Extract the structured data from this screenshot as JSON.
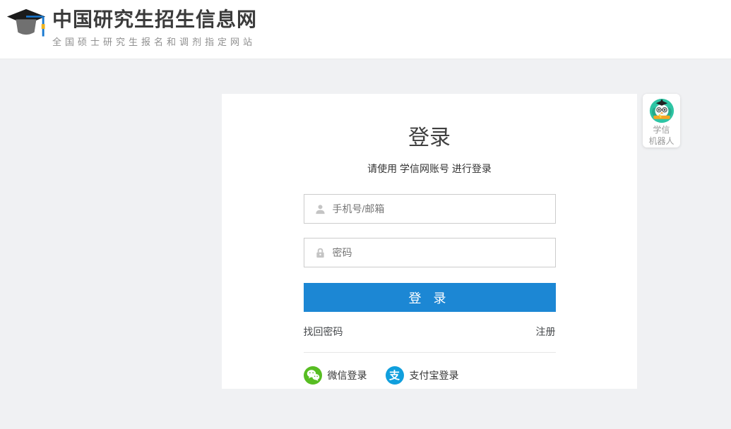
{
  "header": {
    "title": "中国研究生招生信息网",
    "subtitle": "全国硕士研究生报名和调剂指定网站"
  },
  "login": {
    "title": "登录",
    "subtitle": "请使用 学信网账号 进行登录",
    "account_placeholder": "手机号/邮箱",
    "account_value": "",
    "password_placeholder": "密码",
    "password_value": "",
    "login_button": "登 录",
    "forgot_password": "找回密码",
    "register": "注册",
    "wechat_login": "微信登录",
    "alipay_login": "支付宝登录"
  },
  "robot_widget": {
    "label_line1": "学信",
    "label_line2": "机器人"
  },
  "icons": {
    "brand_logo": "graduation-cap-icon",
    "account": "person-icon",
    "password": "lock-icon",
    "wechat": "wechat-icon",
    "alipay": "alipay-icon",
    "robot": "robot-avatar-icon"
  },
  "colors": {
    "page_background": "#f0f1f3",
    "primary_button_blue": "#1c87d4",
    "wechat_green": "#57bd22",
    "alipay_blue": "#109fdd",
    "robot_teal": "#2ec5a4",
    "tassel_blue": "#1878d0"
  }
}
